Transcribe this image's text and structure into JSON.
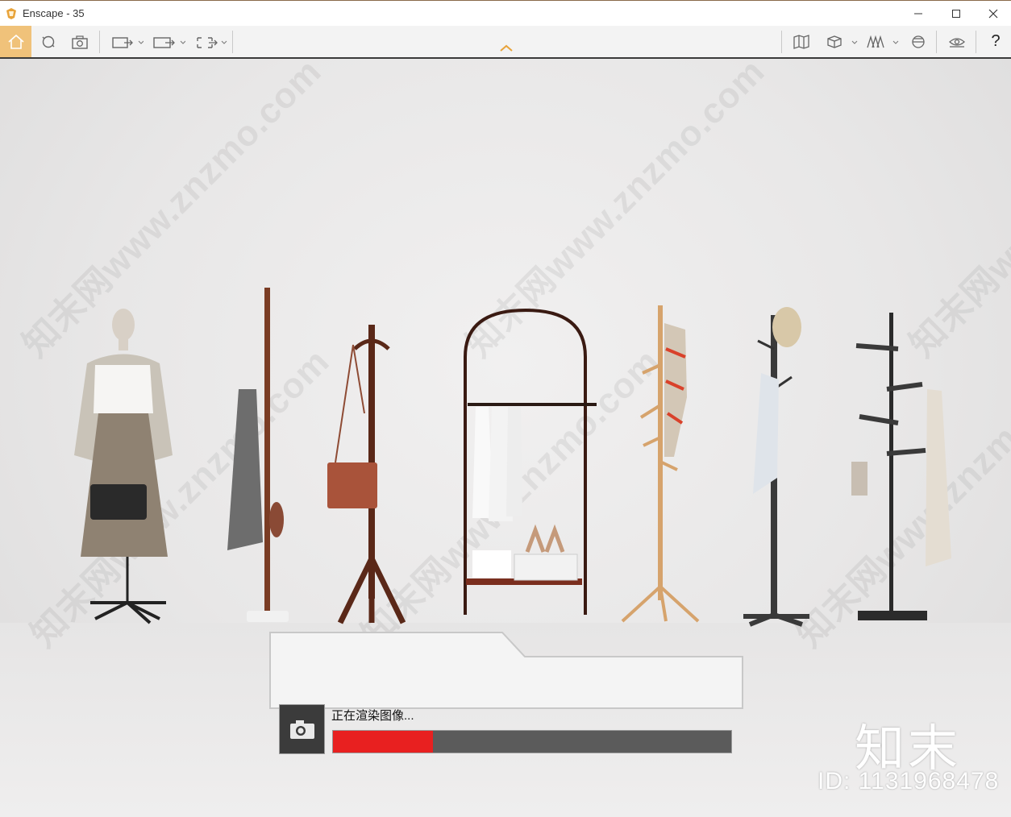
{
  "window": {
    "title": "Enscape - 35",
    "minimize_icon": "minimize-icon",
    "maximize_icon": "maximize-icon",
    "close_icon": "close-icon"
  },
  "toolbar": {
    "left_items": [
      "home-icon",
      "orbit-icon",
      "camera-icon",
      "capture-dropdown-icon",
      "video-dropdown-icon",
      "panorama-dropdown-icon"
    ],
    "center_item": "collapse-toolbar-chevron-icon",
    "right_items": [
      "map-icon",
      "cube-view-icon",
      "asset-library-icon",
      "visual-settings-icon",
      "vr-headset-icon",
      "help-icon"
    ],
    "help_label": "?"
  },
  "colors": {
    "accent_active": "#f0c27a",
    "progress_fill": "#e82020",
    "progress_track": "#5b5b5b"
  },
  "scene": {
    "watermark_text": "知末网www.znzmo.com",
    "brand_logo": "知末",
    "brand_id": "ID: 1131968478",
    "objects": [
      "mannequin",
      "coat-stand-1",
      "coat-stand-2",
      "garment-rack",
      "coat-stand-3",
      "coat-stand-4",
      "coat-stand-5"
    ]
  },
  "render_status": {
    "label": "正在渲染图像...",
    "progress": 0.25
  }
}
